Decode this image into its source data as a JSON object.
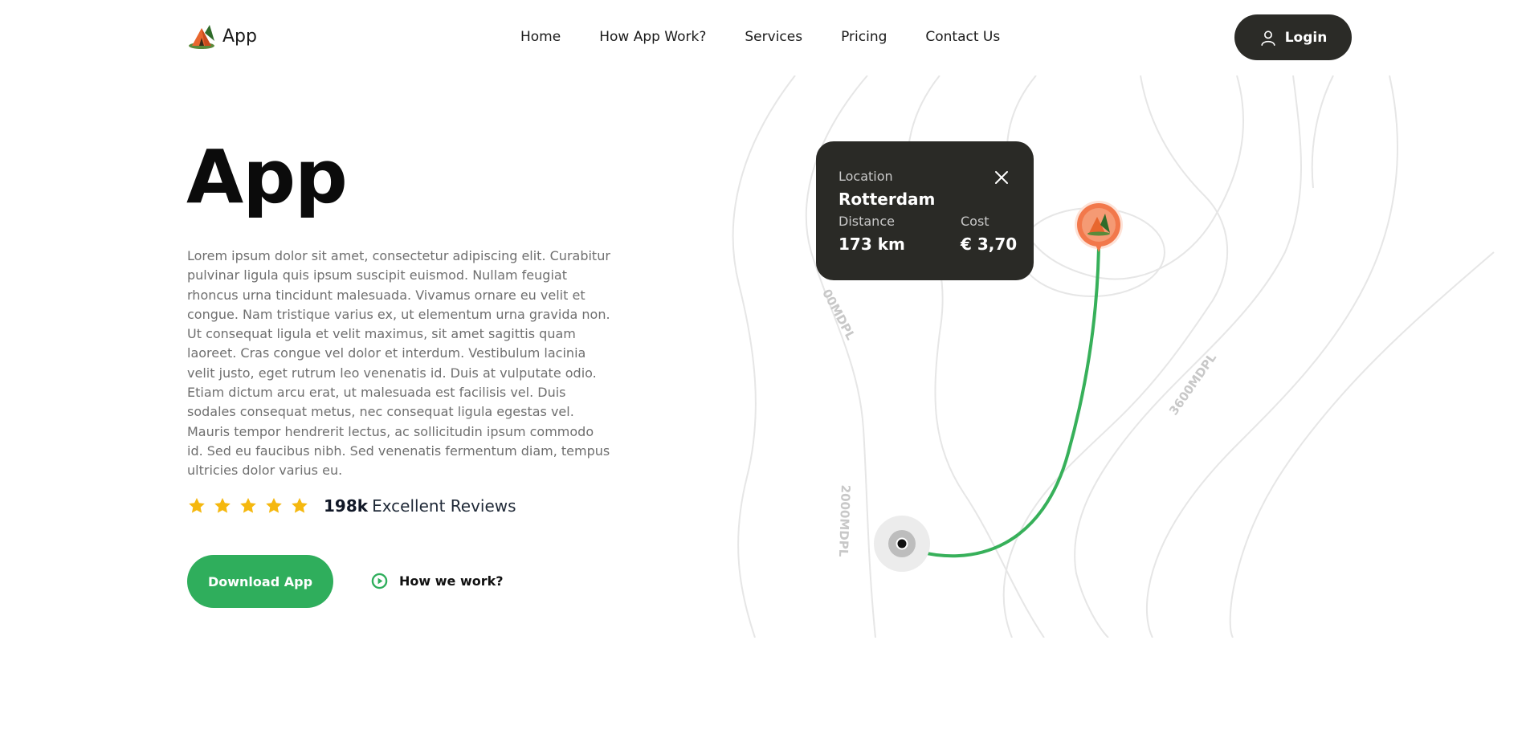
{
  "header": {
    "brand_name": "App",
    "nav": [
      "Home",
      "How App Work?",
      "Services",
      "Pricing",
      "Contact Us"
    ],
    "login_label": "Login"
  },
  "hero": {
    "title": "App",
    "body": "Lorem ipsum dolor sit amet, consectetur adipiscing elit. Curabitur pulvinar ligula quis ipsum suscipit euismod. Nullam feugiat rhoncus urna tincidunt malesuada. Vivamus ornare eu velit et congue. Nam tristique varius ex, ut elementum urna gravida non. Ut consequat ligula et velit maximus, sit amet sagittis quam laoreet. Cras congue vel dolor et interdum. Vestibulum lacinia velit justo, eget rutrum leo venenatis id. Duis at vulputate odio. Etiam dictum arcu erat, ut malesuada est facilisis vel. Duis sodales consequat metus, nec consequat ligula egestas vel. Mauris tempor hendrerit lectus, ac sollicitudin ipsum commodo id. Sed eu faucibus nibh. Sed venenatis fermentum diam, tempus ultricies dolor varius eu.",
    "rating_stars": 5,
    "reviews_count": "198k",
    "reviews_label": "Excellent Reviews",
    "download_label": "Download App",
    "how_label": "How we work?"
  },
  "map": {
    "contour_labels": [
      "00MDPL",
      "3600MDPL",
      "2000MDPL"
    ],
    "card": {
      "location_label": "Location",
      "location_value": "Rotterdam",
      "distance_label": "Distance",
      "distance_value": "173 km",
      "cost_label": "Cost",
      "cost_value": "€ 3,70"
    }
  },
  "colors": {
    "accent_green": "#2fae5c",
    "dark": "#2b2b27",
    "star": "#f5b80f",
    "pin": "#f2784b"
  },
  "icons": {
    "brand": "camp-tent-icon",
    "user": "user-icon",
    "star": "star-icon",
    "play": "play-circle-icon",
    "close": "close-icon",
    "pin": "destination-pin-icon",
    "origin": "origin-dot-icon"
  }
}
